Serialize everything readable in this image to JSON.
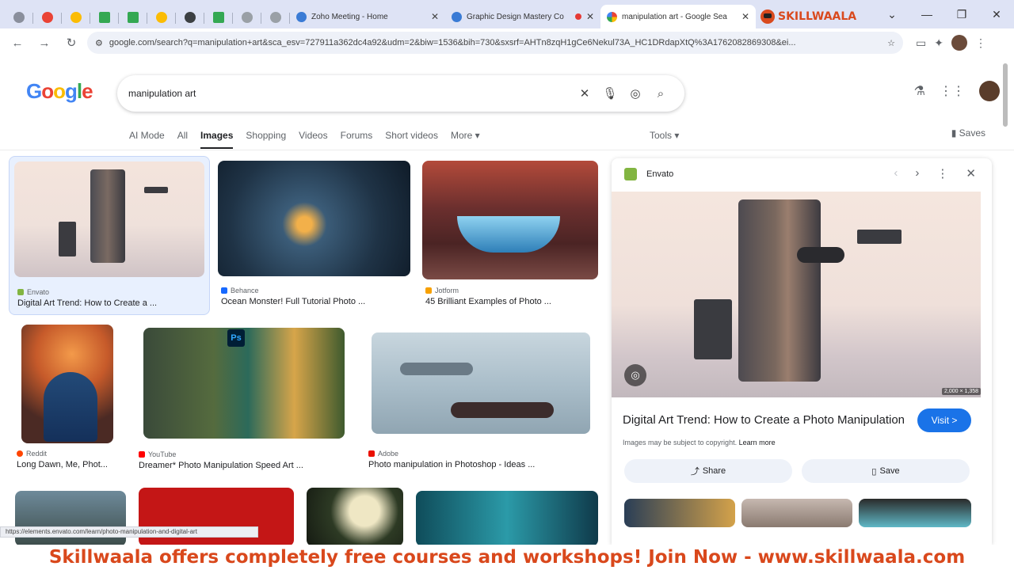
{
  "browser": {
    "tabs": [
      {
        "title": "Zoho Meeting - Home",
        "color": "#3a7bd5"
      },
      {
        "title": "Graphic Design Mastery Co",
        "color": "#3a7bd5",
        "badge_color": "#e53935"
      },
      {
        "title": "manipulation art - Google Sea",
        "color": "#4285f4",
        "active": true
      }
    ],
    "brand": "SKILLWAALA",
    "url": "google.com/search?q=manipulation+art&sca_esv=727911a362dc4a92&udm=2&biw=1536&bih=730&sxsrf=AHTn8zqH1gCe6Nekul73A_HC1DRdapXtQ%3A1762082869308&ei..."
  },
  "google": {
    "logo": "Google",
    "query": "manipulation art",
    "filters": [
      "AI Mode",
      "All",
      "Images",
      "Shopping",
      "Videos",
      "Forums",
      "Short videos",
      "More ▾"
    ],
    "active_filter": "Images",
    "tools": "Tools ▾",
    "saves": "Saves"
  },
  "results": [
    {
      "source": "Envato",
      "title": "Digital Art Trend: How to Create a ...",
      "src_color": "#82b541"
    },
    {
      "source": "Behance",
      "title": "Ocean Monster! Full Tutorial Photo ...",
      "src_color": "#1769ff"
    },
    {
      "source": "Jotform",
      "title": "45 Brilliant Examples of Photo ...",
      "src_color": "#f7a000"
    },
    {
      "source": "Reddit",
      "title": "Long Dawn, Me, Phot...",
      "src_color": "#ff4500"
    },
    {
      "source": "YouTube",
      "title": "Dreamer* Photo Manipulation Speed Art ...",
      "src_color": "#ff0000"
    },
    {
      "source": "Adobe",
      "title": "Photo manipulation in Photoshop - Ideas ...",
      "src_color": "#eb1000"
    }
  ],
  "panel": {
    "source": "Envato",
    "dimensions": "2,000 × 1,358",
    "title": "Digital Art Trend: How to Create a Photo Manipulation",
    "visit": "Visit >",
    "copyright": "Images may be subject to copyright.",
    "learn_more": "Learn more",
    "share": "Share",
    "save": "Save"
  },
  "status_url": "https://elements.envato.com/learn/photo-manipulation-and-digital-art",
  "banner": "Skillwaala offers completely free courses and workshops! Join Now - www.skillwaala.com"
}
